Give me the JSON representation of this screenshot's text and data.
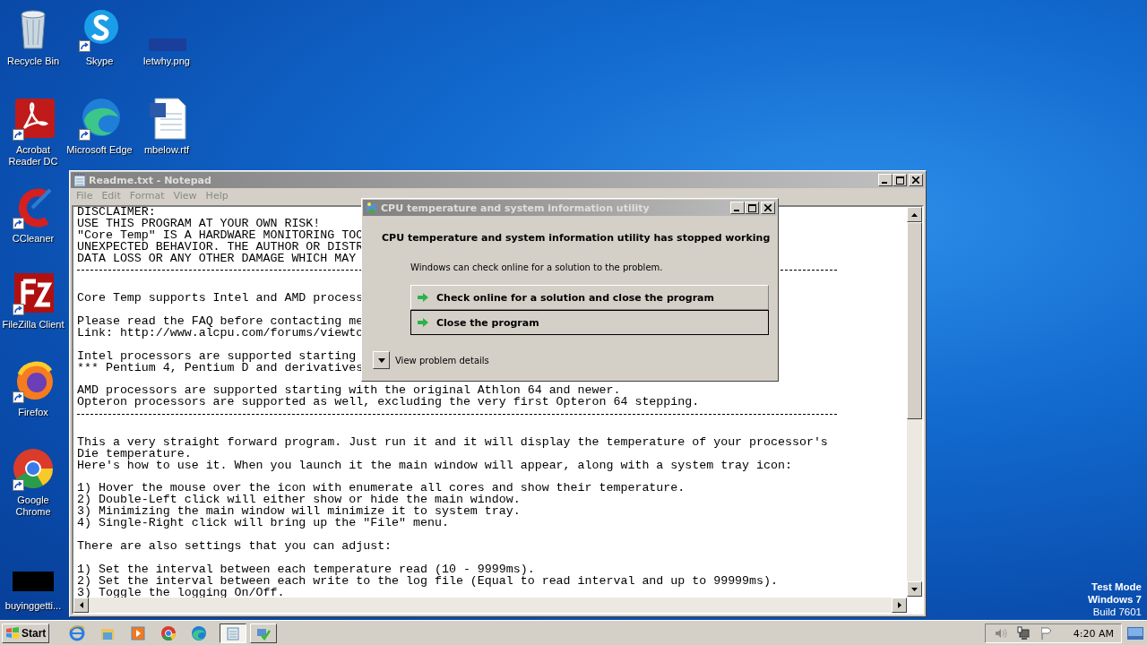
{
  "desktop_icons": [
    {
      "label": "Recycle Bin",
      "shortcut": false
    },
    {
      "label": "Skype",
      "shortcut": true
    },
    {
      "label": "letwhy.png",
      "shortcut": false
    },
    {
      "label": "Acrobat Reader DC",
      "shortcut": true
    },
    {
      "label": "Microsoft Edge",
      "shortcut": true
    },
    {
      "label": "mbelow.rtf",
      "shortcut": false
    },
    {
      "label": "CCleaner",
      "shortcut": true
    },
    {
      "label": "FileZilla Client",
      "shortcut": true
    },
    {
      "label": "Firefox",
      "shortcut": true
    },
    {
      "label": "Google Chrome",
      "shortcut": true
    },
    {
      "label": "buyinggetti...",
      "shortcut": false
    }
  ],
  "notepad": {
    "title": "Readme.txt - Notepad",
    "menu": [
      "File",
      "Edit",
      "Format",
      "View",
      "Help"
    ],
    "lines": [
      {
        "kind": "text",
        "text": "DISCLAIMER:"
      },
      {
        "kind": "text",
        "text": "USE THIS PROGRAM AT YOUR OWN RISK!"
      },
      {
        "kind": "text",
        "text": "\"Core Temp\" IS A HARDWARE MONITORING TOO"
      },
      {
        "kind": "text",
        "text": "UNEXPECTED BEHAVIOR. THE AUTHOR OR DISTR"
      },
      {
        "kind": "text",
        "text": "DATA LOSS OR ANY OTHER DAMAGE WHICH MAY"
      },
      {
        "kind": "rule"
      },
      {
        "kind": "blank"
      },
      {
        "kind": "text",
        "text": "Core Temp supports Intel and AMD process"
      },
      {
        "kind": "blank"
      },
      {
        "kind": "text",
        "text": "Please read the FAQ before contacting me"
      },
      {
        "kind": "text",
        "text": "Link: http://www.alcpu.com/forums/viewto"
      },
      {
        "kind": "blank"
      },
      {
        "kind": "text",
        "text": "Intel processors are supported starting"
      },
      {
        "kind": "text",
        "text": "*** Pentium 4, Pentium D and derivatives"
      },
      {
        "kind": "blank"
      },
      {
        "kind": "text",
        "text": "AMD processors are supported starting with the original Athlon 64 and newer."
      },
      {
        "kind": "text",
        "text": "Opteron processors are supported as well, excluding the very first Opteron 64 stepping."
      },
      {
        "kind": "rule"
      },
      {
        "kind": "blank"
      },
      {
        "kind": "text",
        "text": "This a very straight forward program. Just run it and it will display the temperature of your processor's"
      },
      {
        "kind": "text",
        "text": "Die temperature."
      },
      {
        "kind": "text",
        "text": "Here's how to use it. When you launch it the main window will appear, along with a system tray icon:"
      },
      {
        "kind": "blank"
      },
      {
        "kind": "text",
        "text": "1) Hover the mouse over the icon with enumerate all cores and show their temperature."
      },
      {
        "kind": "text",
        "text": "2) Double-Left click will either show or hide the main window."
      },
      {
        "kind": "text",
        "text": "3) Minimizing the main window will minimize it to system tray."
      },
      {
        "kind": "text",
        "text": "4) Single-Right click will bring up the \"File\" menu."
      },
      {
        "kind": "blank"
      },
      {
        "kind": "text",
        "text": "There are also settings that you can adjust:"
      },
      {
        "kind": "blank"
      },
      {
        "kind": "text",
        "text": "1) Set the interval between each temperature read (10 - 9999ms)."
      },
      {
        "kind": "text",
        "text": "2) Set the interval between each write to the log file (Equal to read interval and up to 99999ms)."
      },
      {
        "kind": "text",
        "text": "3) Toggle the logging On/Off."
      }
    ]
  },
  "dialog": {
    "title": "CPU temperature and system information utility",
    "heading": "CPU temperature and system information utility has stopped working",
    "message": "Windows can check online for a solution to the problem.",
    "options": [
      {
        "label": "Check online for a solution and close the program",
        "selected": false
      },
      {
        "label": "Close the program",
        "selected": true
      }
    ],
    "details": "View problem details"
  },
  "os_notice": [
    "Test Mode",
    "Windows 7",
    "Build 7601"
  ],
  "taskbar": {
    "start": "Start",
    "tasks": [
      {
        "selected": true
      },
      {
        "selected": false
      }
    ],
    "clock": "4:20 AM"
  }
}
